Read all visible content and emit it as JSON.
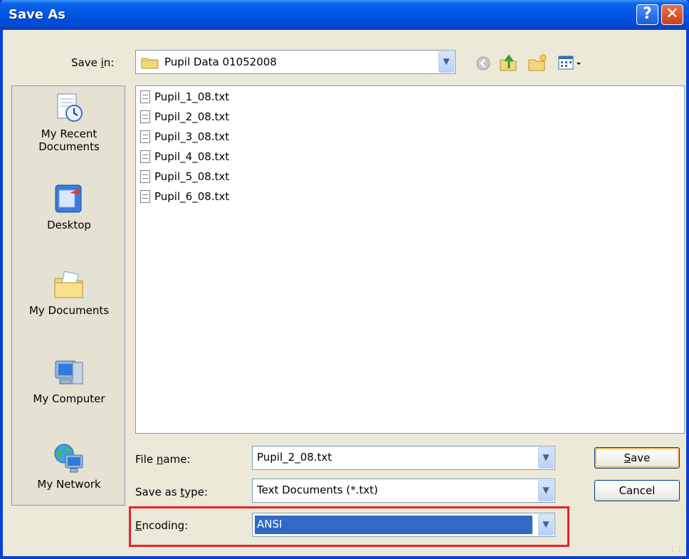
{
  "window": {
    "title": "Save As"
  },
  "titlebar": {
    "help_label": "?",
    "close_label": "✕"
  },
  "save_in": {
    "label_pre": "Save ",
    "label_ul": "i",
    "label_post": "n:",
    "value": "Pupil Data 01052008"
  },
  "toolbar": {
    "icons": [
      "back-icon",
      "up-one-level-icon",
      "new-folder-icon",
      "views-menu-icon"
    ]
  },
  "places": [
    {
      "label_line1": "My Recent",
      "label_line2": "Documents",
      "icon": "my-recent-documents-icon"
    },
    {
      "label_line1": "Desktop",
      "label_line2": "",
      "icon": "desktop-icon"
    },
    {
      "label_line1": "My Documents",
      "label_line2": "",
      "icon": "my-documents-icon"
    },
    {
      "label_line1": "My Computer",
      "label_line2": "",
      "icon": "my-computer-icon"
    },
    {
      "label_line1": "My Network",
      "label_line2": "",
      "icon": "my-network-icon"
    }
  ],
  "files": [
    "Pupil_1_08.txt",
    "Pupil_2_08.txt",
    "Pupil_3_08.txt",
    "Pupil_4_08.txt",
    "Pupil_5_08.txt",
    "Pupil_6_08.txt"
  ],
  "filename": {
    "label_pre": "File ",
    "label_ul": "n",
    "label_post": "ame:",
    "value": "Pupil_2_08.txt"
  },
  "filetype": {
    "label_pre": "Save as ",
    "label_ul": "t",
    "label_post": "ype:",
    "value": "Text Documents (*.txt)"
  },
  "encoding": {
    "label_pre": "",
    "label_ul": "E",
    "label_post": "ncoding:",
    "value": "ANSI"
  },
  "buttons": {
    "save_ul": "S",
    "save_rest": "ave",
    "cancel": "Cancel"
  },
  "colors": {
    "selection": "#316AC5",
    "highlight_border": "#E8222A",
    "titlebar": "#0055E5"
  }
}
